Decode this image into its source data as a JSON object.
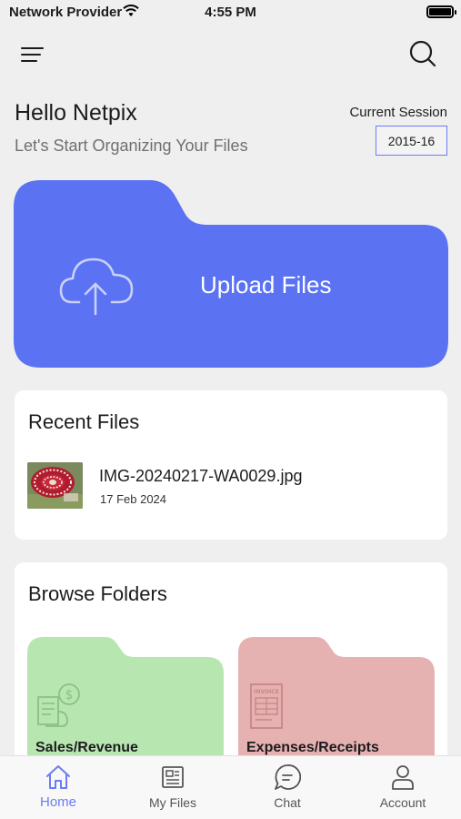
{
  "status_bar": {
    "carrier": "Network Provider",
    "time": "4:55 PM"
  },
  "header": {
    "greeting": "Hello Netpix",
    "subtitle": "Let's Start Organizing Your Files"
  },
  "session": {
    "label": "Current Session",
    "value": "2015-16"
  },
  "upload": {
    "label": "Upload Files",
    "color": "#5b72f2"
  },
  "recent": {
    "title": "Recent Files",
    "files": [
      {
        "name": "IMG-20240217-WA0029.jpg",
        "date": "17 Feb 2024"
      }
    ]
  },
  "browse": {
    "title": "Browse Folders",
    "folders": [
      {
        "label": "Sales/Revenue",
        "color": "#b8e6b1",
        "icon": "sales-receipt-icon"
      },
      {
        "label": "Expenses/Receipts",
        "color": "#e6b1b1",
        "icon": "invoice-icon"
      }
    ]
  },
  "tabs": [
    {
      "label": "Home",
      "icon": "home-icon",
      "active": true
    },
    {
      "label": "My Files",
      "icon": "files-icon",
      "active": false
    },
    {
      "label": "Chat",
      "icon": "chat-icon",
      "active": false
    },
    {
      "label": "Account",
      "icon": "account-icon",
      "active": false
    }
  ],
  "colors": {
    "accent": "#6b7cf5",
    "background": "#efefef"
  }
}
